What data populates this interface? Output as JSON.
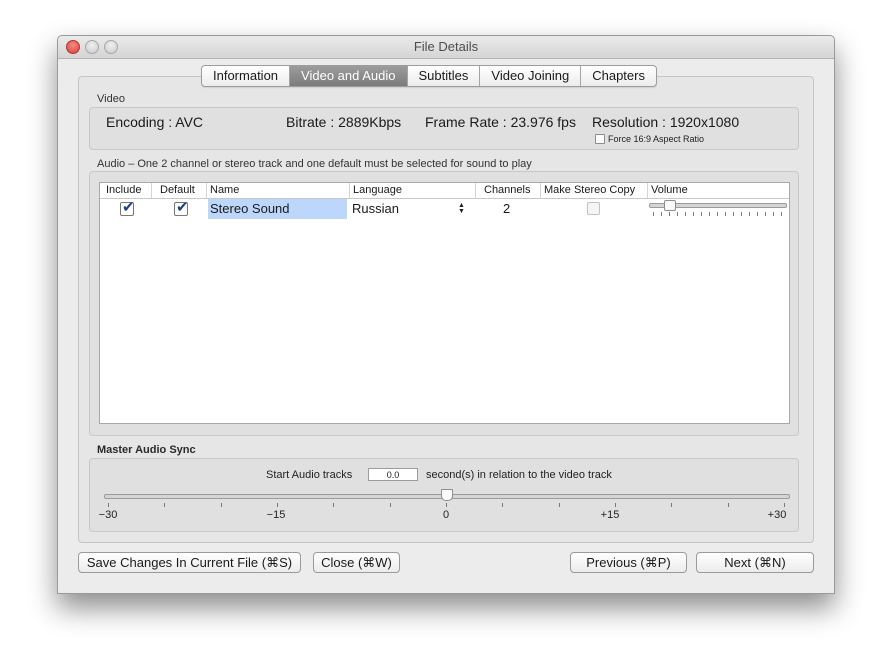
{
  "window": {
    "title": "File Details"
  },
  "tabs": [
    {
      "label": "Information",
      "selected": false
    },
    {
      "label": "Video and Audio",
      "selected": true
    },
    {
      "label": "Subtitles",
      "selected": false
    },
    {
      "label": "Video Joining",
      "selected": false
    },
    {
      "label": "Chapters",
      "selected": false
    }
  ],
  "video": {
    "section_label": "Video",
    "encoding": "Encoding :  AVC",
    "bitrate": "Bitrate :  2889Kbps",
    "frame_rate": "Frame Rate :  23.976 fps",
    "resolution": "Resolution :  1920x1080",
    "force_aspect_label": "Force 16:9 Aspect Ratio",
    "force_aspect_checked": false
  },
  "audio": {
    "section_label": "Audio – One 2 channel or stereo track and one default must be selected for sound to play",
    "columns": [
      "Include",
      "Default",
      "Name",
      "Language",
      "Channels",
      "Make Stereo Copy",
      "Volume"
    ],
    "tracks": [
      {
        "include": true,
        "default": true,
        "name": "Stereo Sound",
        "language": "Russian",
        "channels": "2",
        "make_stereo_copy": false,
        "volume_fraction": 0.15
      }
    ]
  },
  "sync": {
    "section_label": "Master Audio Sync",
    "prefix": "Start Audio tracks",
    "value": "0.0",
    "suffix": "second(s) in relation to the video track",
    "scale_labels": [
      "−30",
      "−15",
      "0",
      "+15",
      "+30"
    ],
    "slider_fraction": 0.5
  },
  "buttons": {
    "save": "Save Changes In Current File (⌘S)",
    "close": "Close (⌘W)",
    "previous": "Previous (⌘P)",
    "next": "Next (⌘N)"
  }
}
